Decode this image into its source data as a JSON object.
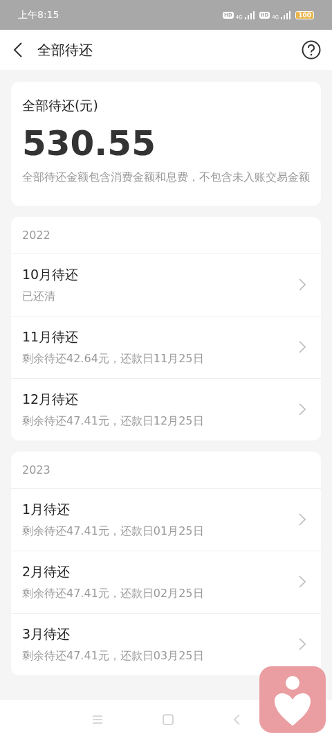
{
  "status_bar": {
    "time": "上午8:15",
    "sims": [
      {
        "badge": "HD",
        "network": "4G"
      },
      {
        "badge": "HD",
        "network": "4G"
      }
    ],
    "battery": "100"
  },
  "header": {
    "title": "全部待还"
  },
  "summary": {
    "label": "全部待还(元)",
    "amount": "530.55",
    "note": "全部待还金额包含消费金额和息费，不包含未入账交易金额"
  },
  "groups": [
    {
      "year": "2022",
      "months": [
        {
          "title": "10月待还",
          "detail": "已还清"
        },
        {
          "title": "11月待还",
          "detail": "剩余待还42.64元，还款日11月25日"
        },
        {
          "title": "12月待还",
          "detail": "剩余待还47.41元，还款日12月25日"
        }
      ]
    },
    {
      "year": "2023",
      "months": [
        {
          "title": "1月待还",
          "detail": "剩余待还47.41元，还款日01月25日"
        },
        {
          "title": "2月待还",
          "detail": "剩余待还47.41元，还款日02月25日"
        },
        {
          "title": "3月待还",
          "detail": "剩余待还47.41元，还款日03月25日"
        }
      ]
    }
  ]
}
